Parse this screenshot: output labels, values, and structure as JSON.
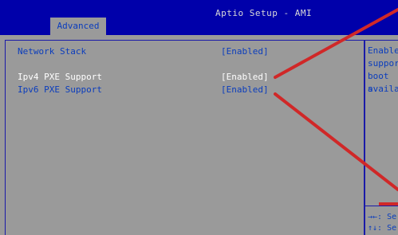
{
  "window": {
    "title": "Aptio Setup - AMI",
    "active_tab": "Advanced"
  },
  "settings": [
    {
      "label": "Network Stack",
      "value": "[Enabled]",
      "highlighted": false
    },
    {
      "label": "Ipv4 PXE Support",
      "value": "[Enabled]",
      "highlighted": true
    },
    {
      "label": "Ipv6 PXE Support",
      "value": "[Enabled]",
      "highlighted": false
    }
  ],
  "help_panel": {
    "lines": [
      "Enable",
      "suppor",
      "boot s",
      "availa"
    ]
  },
  "key_legend": {
    "lines": [
      "→←: Se",
      "↑↓: Se"
    ]
  },
  "colors": {
    "bios_blue": "#0000aa",
    "panel_gray": "#9a9a9a",
    "accent_blue": "#0b3dbd",
    "annotation_red": "#d02828"
  }
}
